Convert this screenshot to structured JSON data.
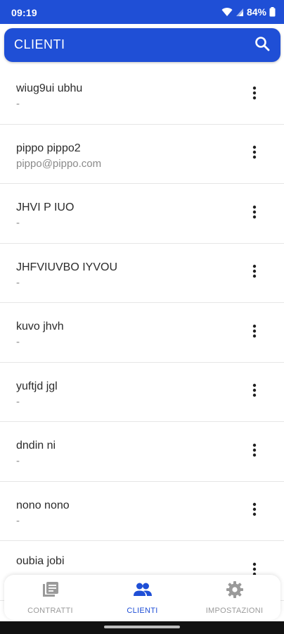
{
  "status_bar": {
    "time": "09:19",
    "battery": "84%"
  },
  "app_bar": {
    "title": "CLIENTI",
    "search_icon": "search-icon"
  },
  "clients": [
    {
      "name": "wiug9ui ubhu",
      "detail": "-"
    },
    {
      "name": "pippo pippo2",
      "detail": "pippo@pippo.com"
    },
    {
      "name": "JHVI P IUO",
      "detail": "-"
    },
    {
      "name": "JHFVIUVBO IYVOU",
      "detail": "-"
    },
    {
      "name": "kuvo jhvh",
      "detail": "-"
    },
    {
      "name": "yuftjd jgl",
      "detail": "-"
    },
    {
      "name": "dndin ni",
      "detail": "-"
    },
    {
      "name": "nono nono",
      "detail": "-"
    },
    {
      "name": "oubia jobi",
      "detail": ""
    }
  ],
  "bottom_nav": {
    "items": [
      {
        "label": "CONTRATTI",
        "icon": "document-icon",
        "active": false
      },
      {
        "label": "CLIENTI",
        "icon": "people-icon",
        "active": true
      },
      {
        "label": "IMPOSTAZIONI",
        "icon": "gear-icon",
        "active": false
      }
    ]
  },
  "colors": {
    "primary": "#1f4fd6",
    "inactive": "#9a9a9a",
    "text": "#2b2b2b",
    "subtext": "#8a8a8a"
  }
}
